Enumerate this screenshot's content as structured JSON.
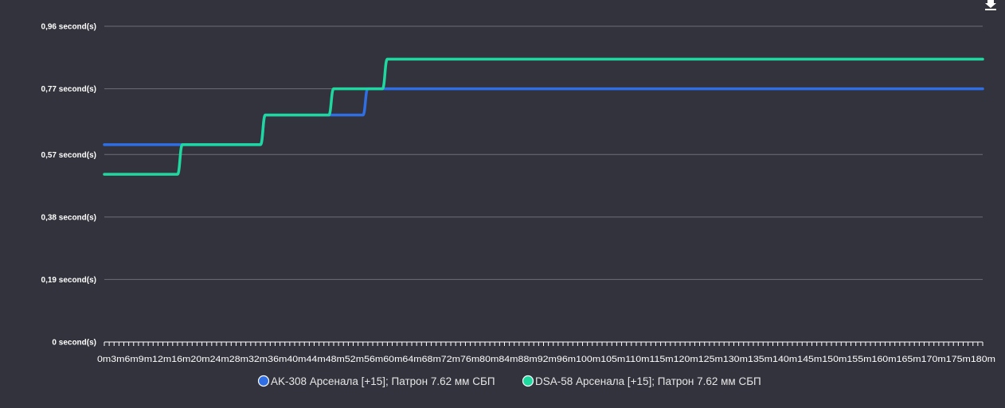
{
  "icons": {
    "download": "download-icon"
  },
  "colors": {
    "background": "#33333d",
    "grid": "#6e6e78",
    "axis": "#ffffff",
    "text": "#ffffff"
  },
  "chart_data": {
    "type": "line",
    "title": "",
    "xlabel": "",
    "ylabel": "",
    "x_categories": [
      "0m",
      "3m",
      "6m",
      "9m",
      "12m",
      "16m",
      "20m",
      "24m",
      "28m",
      "32m",
      "36m",
      "40m",
      "44m",
      "48m",
      "52m",
      "56m",
      "60m",
      "64m",
      "68m",
      "72m",
      "76m",
      "80m",
      "84m",
      "88m",
      "92m",
      "96m",
      "100m",
      "105m",
      "110m",
      "115m",
      "120m",
      "125m",
      "130m",
      "135m",
      "140m",
      "145m",
      "150m",
      "155m",
      "160m",
      "165m",
      "170m",
      "175m",
      "180m"
    ],
    "y_ticks": [
      {
        "value": 0,
        "label": "0 second(s)"
      },
      {
        "value": 0.19,
        "label": "0,19 second(s)"
      },
      {
        "value": 0.38,
        "label": "0,38 second(s)"
      },
      {
        "value": 0.57,
        "label": "0,57 second(s)"
      },
      {
        "value": 0.77,
        "label": "0,77 second(s)"
      },
      {
        "value": 0.96,
        "label": "0,96 second(s)"
      }
    ],
    "ylim": [
      0,
      0.96
    ],
    "grid": true,
    "legend_position": "bottom",
    "series": [
      {
        "name": "AK-308 Арсенала [+15]; Патрон 7.62 мм СБП",
        "color": "#2f6ee3",
        "points": [
          [
            0,
            0.6
          ],
          [
            32,
            0.6
          ],
          [
            33,
            0.69
          ],
          [
            53,
            0.69
          ],
          [
            54,
            0.77
          ],
          [
            180,
            0.77
          ]
        ]
      },
      {
        "name": "DSA-58 Арсенала [+15]; Патрон 7.62 мм СБП",
        "color": "#1fd8a0",
        "points": [
          [
            0,
            0.51
          ],
          [
            15,
            0.51
          ],
          [
            16,
            0.6
          ],
          [
            32,
            0.6
          ],
          [
            33,
            0.69
          ],
          [
            46,
            0.69
          ],
          [
            47,
            0.77
          ],
          [
            57,
            0.77
          ],
          [
            58,
            0.86
          ],
          [
            180,
            0.86
          ]
        ]
      }
    ]
  }
}
